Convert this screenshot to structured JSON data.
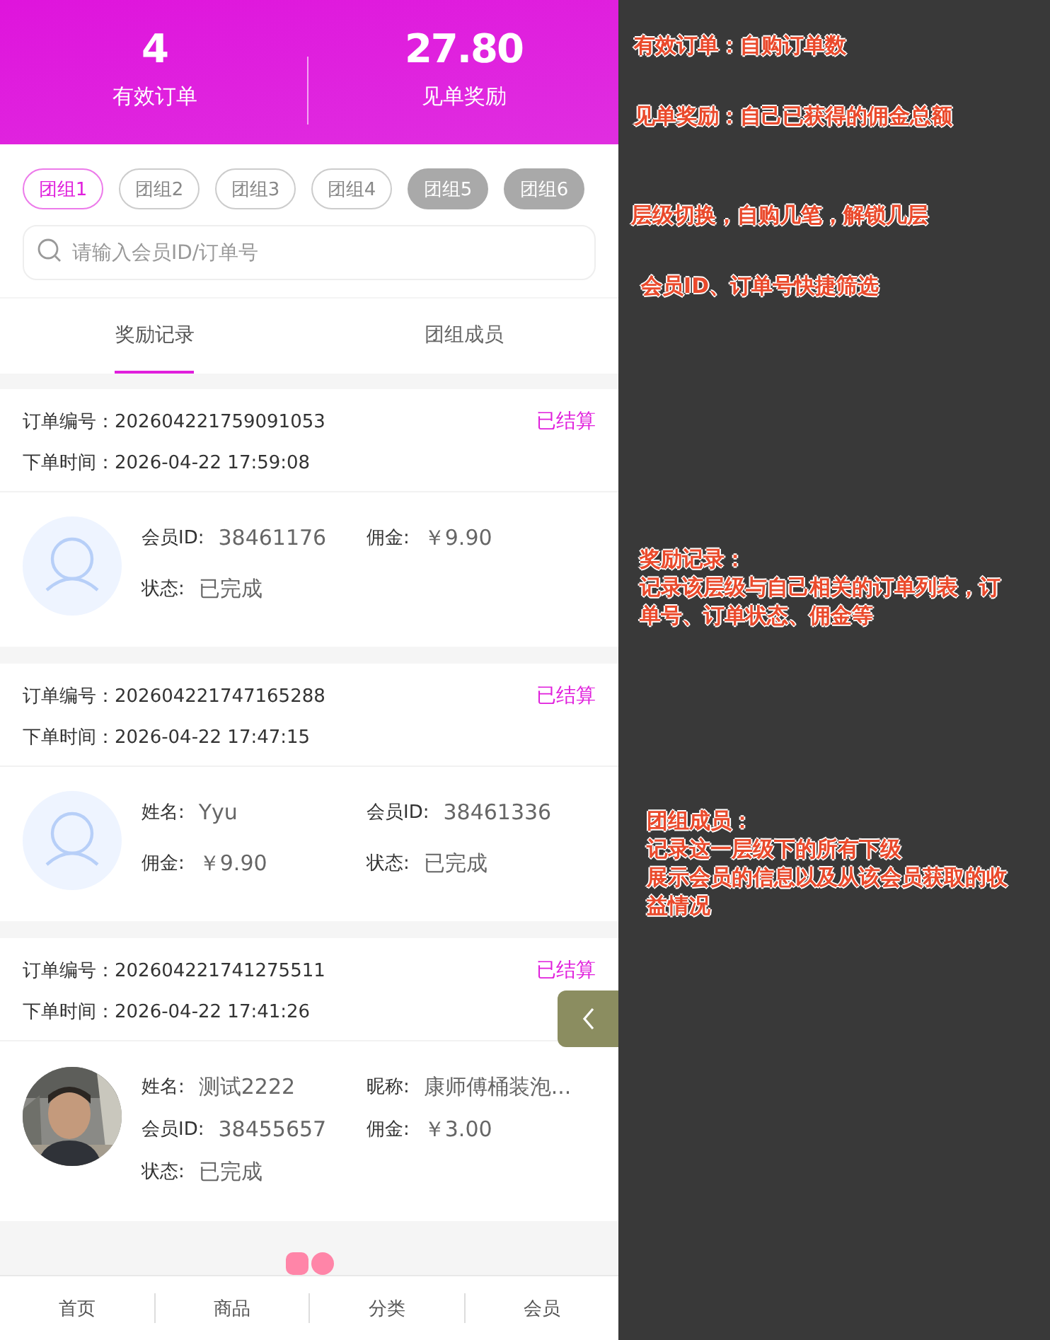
{
  "stats": [
    {
      "value": "4",
      "label": "有效订单"
    },
    {
      "value": "27.80",
      "label": "见单奖励"
    }
  ],
  "groups": [
    {
      "label": "团组1",
      "selected": true,
      "locked": false
    },
    {
      "label": "团组2",
      "selected": false,
      "locked": false
    },
    {
      "label": "团组3",
      "selected": false,
      "locked": false
    },
    {
      "label": "团组4",
      "selected": false,
      "locked": false
    },
    {
      "label": "团组5",
      "selected": false,
      "locked": true
    },
    {
      "label": "团组6",
      "selected": false,
      "locked": true
    }
  ],
  "search": {
    "placeholder": "请输入会员ID/订单号"
  },
  "tabs": [
    {
      "label": "奖励记录",
      "selected": true
    },
    {
      "label": "团组成员",
      "selected": false
    }
  ],
  "orders": [
    {
      "number_label": "订单编号：",
      "number": "202604221759091053",
      "time_label": "下单时间：",
      "time": "2026-04-22 17:59:08",
      "status": "已结算",
      "kind": "placeholder",
      "fields": [
        {
          "label": "会员ID:",
          "value": "38461176"
        },
        {
          "label": "佣金:",
          "value": "￥9.90"
        },
        {
          "label": "状态:",
          "value": "已完成"
        }
      ]
    },
    {
      "number_label": "订单编号：",
      "number": "202604221747165288",
      "time_label": "下单时间：",
      "time": "2026-04-22 17:47:15",
      "status": "已结算",
      "kind": "placeholder",
      "fields": [
        {
          "label": "姓名:",
          "value": "Yyu"
        },
        {
          "label": "会员ID:",
          "value": "38461336"
        },
        {
          "label": "佣金:",
          "value": "￥9.90"
        },
        {
          "label": "状态:",
          "value": "已完成"
        }
      ]
    },
    {
      "number_label": "订单编号：",
      "number": "202604221741275511",
      "time_label": "下单时间：",
      "time": "2026-04-22 17:41:26",
      "status": "已结算",
      "fields": [
        {
          "label": "姓名:",
          "value": "测试2222"
        },
        {
          "label": "昵称:",
          "value": "康师傅桶装泡..."
        },
        {
          "label": "会员ID:",
          "value": "38455657"
        },
        {
          "label": "佣金:",
          "value": "￥3.00"
        },
        {
          "label": "状态:",
          "value": "已完成"
        }
      ]
    }
  ],
  "nav": [
    "首页",
    "商品",
    "分类",
    "会员"
  ],
  "annotations": [
    {
      "lines": [
        "有效订单：自购订单数"
      ]
    },
    {
      "lines": [
        "见单奖励：自己已获得的佣金总额"
      ]
    },
    {
      "lines": [
        "层级切换，自购几笔，解锁几层"
      ]
    },
    {
      "lines": [
        "会员ID、订单号快捷筛选"
      ]
    },
    {
      "lines": [
        "奖励记录：",
        "记录该层级与自己相关的订单列表，订",
        "单号、订单状态、佣金等"
      ]
    },
    {
      "lines": [
        "团组成员：",
        "记录这一层级下的所有下级",
        "展示会员的信息以及从该会员获取的收",
        "益情况"
      ]
    }
  ]
}
